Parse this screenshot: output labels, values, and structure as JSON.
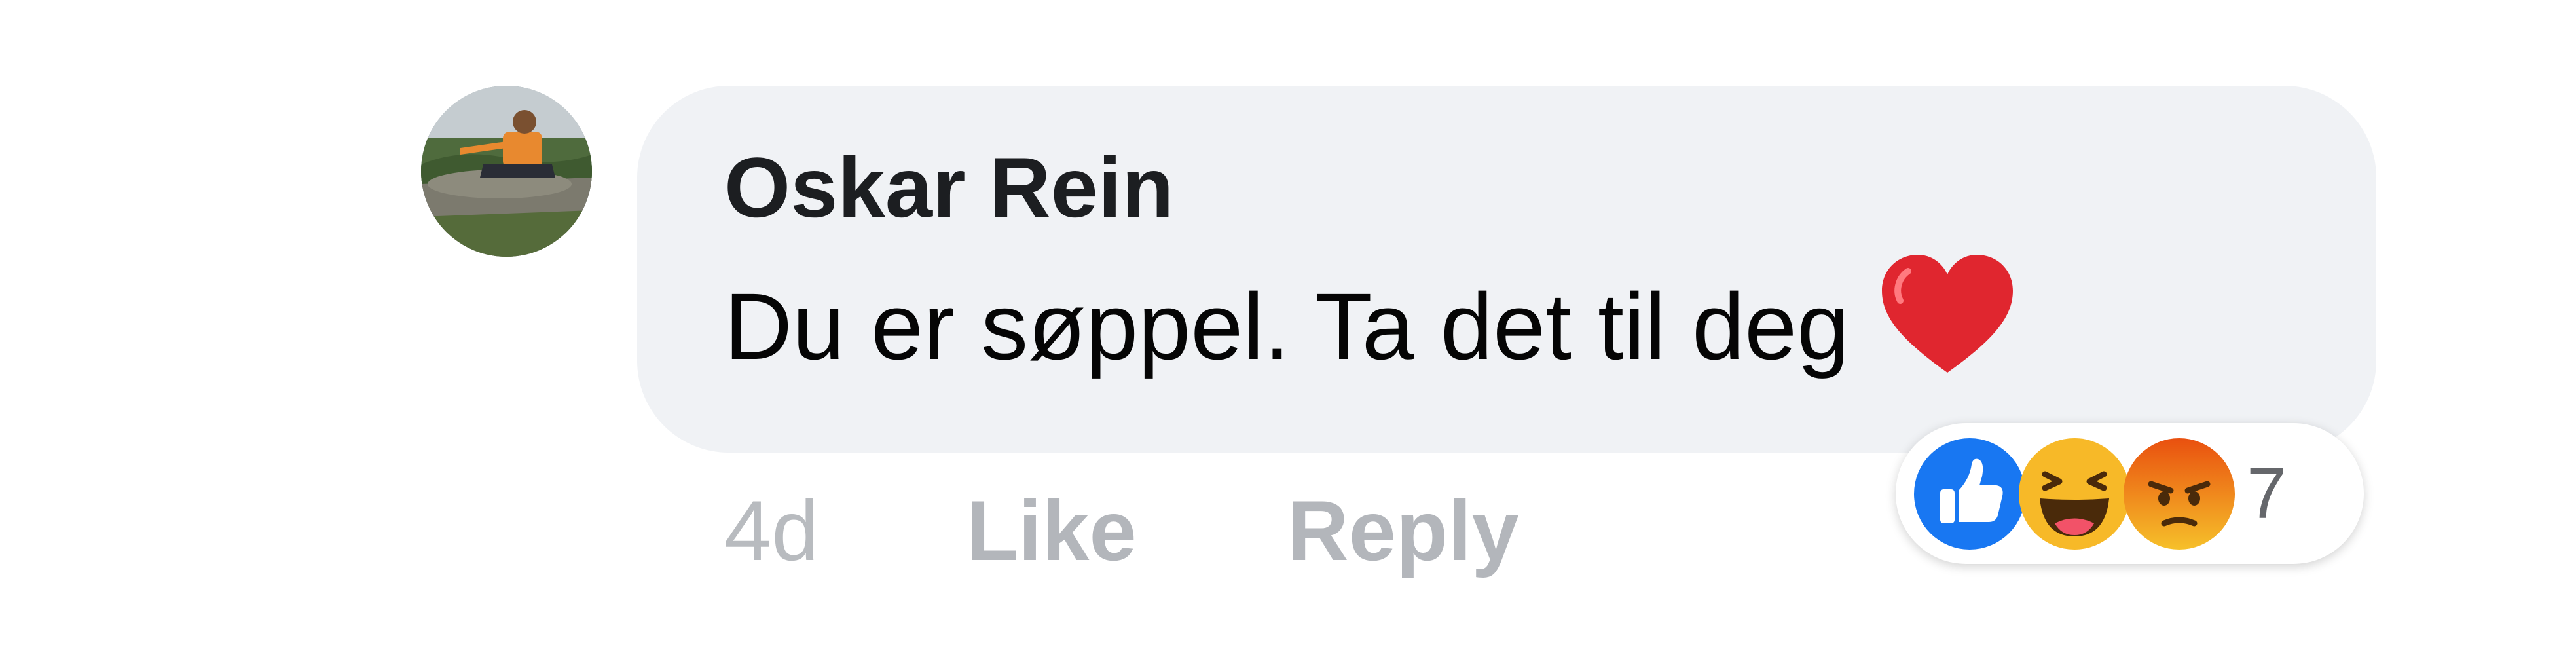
{
  "comment": {
    "author": "Oskar Rein",
    "text": "Du er søppel. Ta det til deg",
    "emoji": "red-heart",
    "timestamp": "4d",
    "actions": {
      "like_label": "Like",
      "reply_label": "Reply"
    },
    "reactions": {
      "types": [
        "like",
        "haha",
        "angry"
      ],
      "count": "7"
    }
  },
  "colors": {
    "bubble_bg": "#f0f2f5",
    "action_text": "#b3b6bb",
    "like_blue": "#1877f2",
    "haha_yellow": "#f7b928",
    "angry_orange": "#e9710f",
    "heart_red": "#e0262f"
  }
}
